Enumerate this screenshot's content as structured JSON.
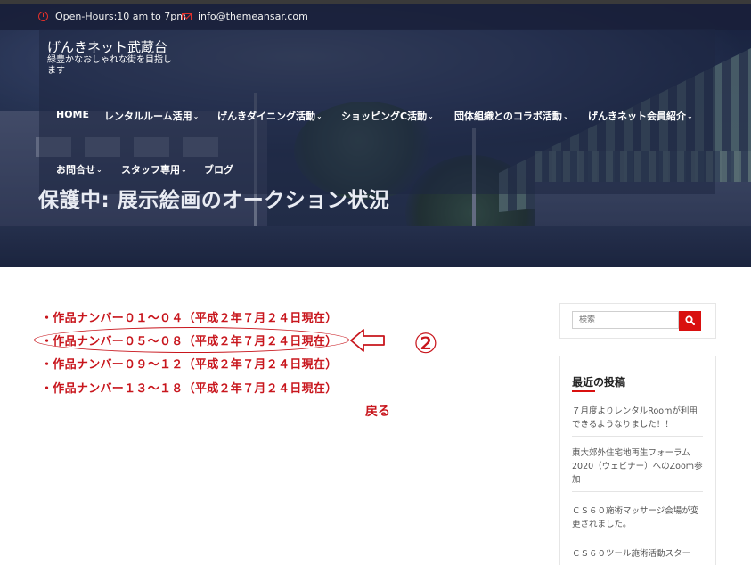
{
  "topbar": {
    "hours": "Open-Hours:10 am to 7pm",
    "email": "info@themeansar.com"
  },
  "site": {
    "title": "げんきネット武蔵台",
    "description": "緑豊かなおしゃれな街を目指します"
  },
  "nav": {
    "caret": "⌄",
    "row1": [
      "HOME",
      "レンタルルーム活用",
      "げんきダイニング活動",
      "ショッピングC活動",
      "団体組織とのコラボ活動",
      "げんきネット会員紹介"
    ],
    "row2": [
      "お問合せ",
      "スタッフ専用",
      "ブログ"
    ]
  },
  "page": {
    "heading": "保護中: 展示絵画のオークション状況"
  },
  "content": {
    "links": [
      "・作品ナンバー０１～０４（平成２年７月２４日現在）",
      "・作品ナンバー０５～０８（平成２年７月２４日現在）",
      "・作品ナンバー０９～１２（平成２年７月２４日現在）",
      "・作品ナンバー１３～１８（平成２年７月２４日現在）"
    ],
    "annotation_number": "②",
    "back_label": "戻る",
    "accent_color": "#c8161d"
  },
  "sidebar": {
    "search_placeholder": "検索",
    "recent_title": "最近の投稿",
    "recent_posts": [
      "７月度よりレンタルRoomが利用できるようなりました！！",
      "東大郊外住宅地再生フォーラム2020（ウェビナー）へのZoom参加",
      "ＣＳ６０施術マッサージ会場が変更されました。",
      "ＣＳ６０ツール施術活動スター"
    ],
    "accent_color": "#d9100f"
  }
}
